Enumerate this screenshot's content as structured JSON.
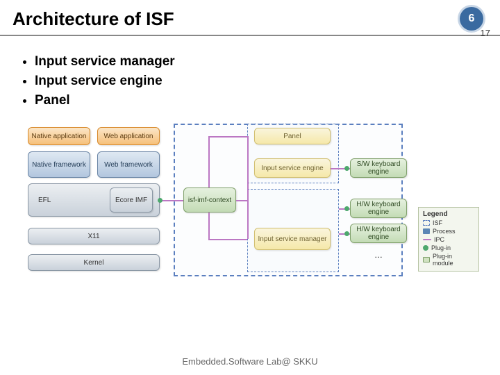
{
  "title": "Architecture of ISF",
  "page_current": "6",
  "page_total": "17",
  "bullets": [
    "Input service manager",
    "Input service engine",
    "Panel"
  ],
  "footer": "Embedded.Software Lab@ SKKU",
  "diagram": {
    "native_app": "Native application",
    "web_app": "Web application",
    "native_fw": "Native framework",
    "web_fw": "Web framework",
    "efl": "EFL",
    "ecore_imf": "Ecore IMF",
    "x11": "X11",
    "kernel": "Kernel",
    "isf_imf_ctx": "isf-imf-context",
    "panel": "Panel",
    "ise": "Input service engine",
    "ism": "Input service manager",
    "sw_kbd": "S/W keyboard engine",
    "hw_kbd1": "H/W keyboard engine",
    "hw_kbd2": "H/W keyboard engine",
    "ellipsis": "…"
  },
  "legend": {
    "title": "Legend",
    "isf": "ISF",
    "process": "Process",
    "ipc": "IPC",
    "plugin": "Plug-in",
    "plugin_module": "Plug-in module"
  }
}
